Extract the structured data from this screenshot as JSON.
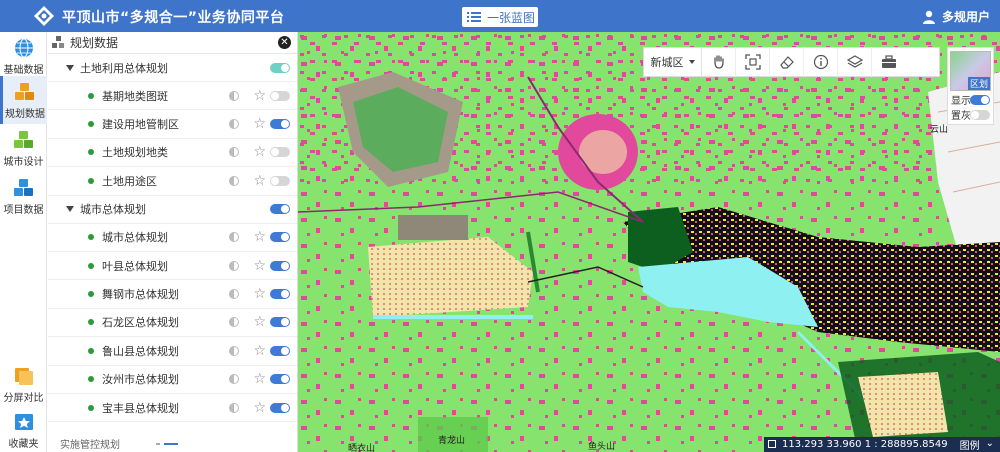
{
  "header": {
    "title": "平顶山市“多规合一”业务协同平台",
    "blueprint_label": "一张蓝图",
    "user_name": "多规用户"
  },
  "rail": {
    "items": [
      {
        "label": "基础数据",
        "icon": "globe-icon"
      },
      {
        "label": "规划数据",
        "icon": "cubes-icon"
      },
      {
        "label": "城市设计",
        "icon": "cubes-icon"
      },
      {
        "label": "项目数据",
        "icon": "cubes-icon"
      },
      {
        "label": "分屏对比",
        "icon": "split-screen-icon"
      },
      {
        "label": "收藏夹",
        "icon": "favorite-icon"
      }
    ]
  },
  "panel": {
    "title": "规划数据",
    "groups": [
      {
        "label": "土地利用总体规划",
        "items": [
          "基期地类图斑",
          "建设用地管制区",
          "土地规划地类",
          "土地用途区"
        ]
      },
      {
        "label": "城市总体规划",
        "items": [
          "城市总体规划",
          "叶县总体规划",
          "舞钢市总体规划",
          "石龙区总体规划",
          "鲁山县总体规划",
          "汝州市总体规划",
          "宝丰县总体规划"
        ]
      }
    ],
    "footer_label": "实施管控规划"
  },
  "toolbar": {
    "district": "新城区",
    "tools": [
      "pan-hand-icon",
      "full-extent-icon",
      "eraser-icon",
      "info-icon",
      "layers-icon",
      "toolbox-icon"
    ]
  },
  "region": {
    "label": "区划",
    "show_label": "显示",
    "gray_label": "置灰"
  },
  "map": {
    "labels": [
      "云山",
      "晒衣山",
      "青龙山",
      "鱼头山"
    ]
  },
  "status": {
    "coords": "113.293  33.960  1 : 288895.8549",
    "legend": "图例"
  },
  "colors": {
    "header": "#3e74c9",
    "map_base": "#86e36d",
    "urban": "#e2489c",
    "water": "#8ef0f0",
    "toggle_on": "#3f7ad6"
  }
}
